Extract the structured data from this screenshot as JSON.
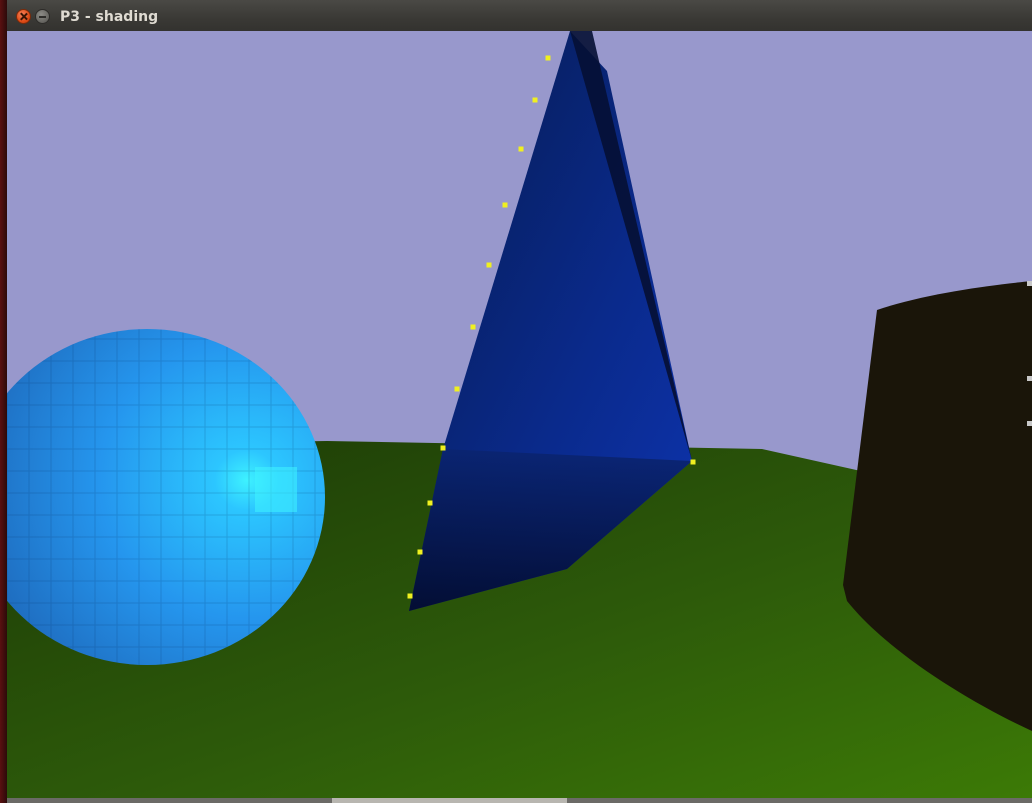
{
  "window": {
    "title": "P3 - shading"
  },
  "icons": {
    "close": "close-icon",
    "minimize": "minimize-icon"
  },
  "scene": {
    "background_color": "#9898cc",
    "ground_color": "#2e5a0a",
    "sphere_color": "#2a9cf2",
    "cone_color": "#0c2a8a",
    "cylinder_color": "#1a1509",
    "control_point_color": "#f0f020"
  }
}
